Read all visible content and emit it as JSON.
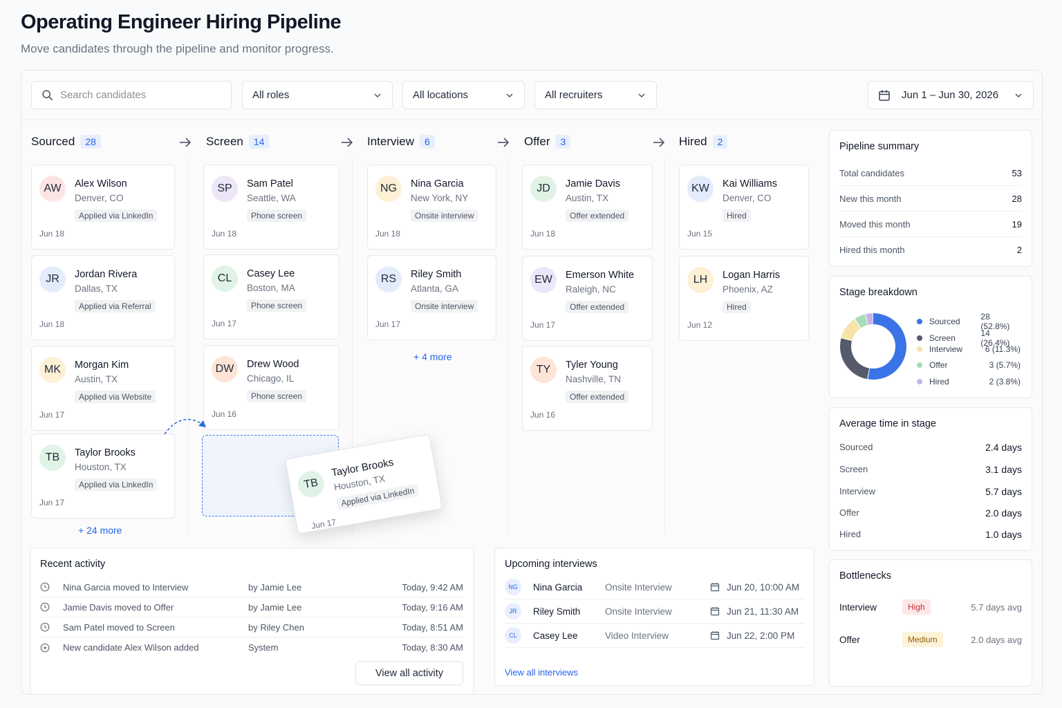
{
  "page": {
    "title": "Operating Engineer Hiring Pipeline",
    "subtitle": "Move candidates through the pipeline and monitor progress."
  },
  "filters": {
    "search_placeholder": "Search candidates",
    "role": "All roles",
    "location": "All locations",
    "recruiter": "All recruiters",
    "date_range": "Jun 1 – Jun 30, 2026"
  },
  "columns": [
    {
      "name": "Sourced",
      "count": "28",
      "more": "+ 24 more"
    },
    {
      "name": "Screen",
      "count": "14",
      "more": ""
    },
    {
      "name": "Interview",
      "count": "6",
      "more": "+ 4 more"
    },
    {
      "name": "Offer",
      "count": "3",
      "more": ""
    },
    {
      "name": "Hired",
      "count": "2",
      "more": ""
    }
  ],
  "cards": {
    "sourced": [
      {
        "initials": "AW",
        "name": "Alex Wilson",
        "location": "Denver, CO",
        "tag": "Applied via LinkedIn",
        "date": "Jun 18",
        "color": "#fde4e4"
      },
      {
        "initials": "JR",
        "name": "Jordan Rivera",
        "location": "Dallas, TX",
        "tag": "Applied via Referral",
        "date": "Jun 18",
        "color": "#e3ecfb"
      },
      {
        "initials": "MK",
        "name": "Morgan Kim",
        "location": "Austin, TX",
        "tag": "Applied via Website",
        "date": "Jun 17",
        "color": "#fdf0d5"
      },
      {
        "initials": "TB",
        "name": "Taylor Brooks",
        "location": "Houston, TX",
        "tag": "Applied via LinkedIn",
        "date": "Jun 17",
        "color": "#e0f3e6"
      }
    ],
    "screen": [
      {
        "initials": "SP",
        "name": "Sam Patel",
        "location": "Seattle, WA",
        "tag": "Phone screen",
        "date": "Jun 18",
        "color": "#ece6f8"
      },
      {
        "initials": "CL",
        "name": "Casey Lee",
        "location": "Boston, MA",
        "tag": "Phone screen",
        "date": "Jun 17",
        "color": "#e0f3e6"
      },
      {
        "initials": "DW",
        "name": "Drew Wood",
        "location": "Chicago, IL",
        "tag": "Phone screen",
        "date": "Jun 16",
        "color": "#fde4d6"
      }
    ],
    "interview": [
      {
        "initials": "NG",
        "name": "Nina Garcia",
        "location": "New York, NY",
        "tag": "Onsite interview",
        "date": "Jun 18",
        "color": "#fdf0d5"
      },
      {
        "initials": "RS",
        "name": "Riley Smith",
        "location": "Atlanta, GA",
        "tag": "Onsite interview",
        "date": "Jun 17",
        "color": "#e3ecfb"
      }
    ],
    "offer": [
      {
        "initials": "JD",
        "name": "Jamie Davis",
        "location": "Austin, TX",
        "tag": "Offer extended",
        "date": "Jun 18",
        "color": "#e0f3e6"
      },
      {
        "initials": "EW",
        "name": "Emerson White",
        "location": "Raleigh, NC",
        "tag": "Offer extended",
        "date": "Jun 17",
        "color": "#ece6f8"
      },
      {
        "initials": "TY",
        "name": "Tyler Young",
        "location": "Nashville, TN",
        "tag": "Offer extended",
        "date": "Jun 16",
        "color": "#fde4d6"
      }
    ],
    "hired": [
      {
        "initials": "KW",
        "name": "Kai Williams",
        "location": "Denver, CO",
        "tag": "Hired",
        "date": "Jun 15",
        "color": "#e3ecfb"
      },
      {
        "initials": "LH",
        "name": "Logan Harris",
        "location": "Phoenix, AZ",
        "tag": "Hired",
        "date": "Jun 12",
        "color": "#fdf0d5"
      }
    ]
  },
  "dragging": {
    "initials": "TB",
    "name": "Taylor Brooks",
    "location": "Houston, TX",
    "tag": "Applied via LinkedIn",
    "date": "Jun 17",
    "color": "#e0f3e6"
  },
  "summary": {
    "title": "Pipeline summary",
    "rows": [
      {
        "label": "Total candidates",
        "value": "53"
      },
      {
        "label": "New this month",
        "value": "28"
      },
      {
        "label": "Moved this month",
        "value": "19"
      },
      {
        "label": "Hired this month",
        "value": "2"
      }
    ]
  },
  "breakdown": {
    "title": "Stage breakdown",
    "stages": [
      {
        "label": "Sourced",
        "count": 28,
        "display": "28 (52.8%)",
        "color": "#3b74e6"
      },
      {
        "label": "Screen",
        "count": 14,
        "display": "14 (26.4%)",
        "color": "#555b6b"
      },
      {
        "label": "Interview",
        "count": 6,
        "display": "6 (11.3%)",
        "color": "#f8e3a8"
      },
      {
        "label": "Offer",
        "count": 3,
        "display": "3 (5.7%)",
        "color": "#a8dcb8"
      },
      {
        "label": "Hired",
        "count": 2,
        "display": "2 (3.8%)",
        "color": "#c3b4ec"
      }
    ]
  },
  "avg_time": {
    "title": "Average time in stage",
    "rows": [
      {
        "label": "Sourced",
        "value": "2.4 days"
      },
      {
        "label": "Screen",
        "value": "3.1 days"
      },
      {
        "label": "Interview",
        "value": "5.7 days"
      },
      {
        "label": "Offer",
        "value": "2.0 days"
      },
      {
        "label": "Hired",
        "value": "1.0 days"
      }
    ]
  },
  "bottlenecks": {
    "title": "Bottlenecks",
    "rows": [
      {
        "stage": "Interview",
        "level": "High",
        "avg": "5.7 days avg",
        "bg": "#fde8e8",
        "fg": "#c53030"
      },
      {
        "stage": "Offer",
        "level": "Medium",
        "avg": "2.0 days avg",
        "bg": "#fdf3d8",
        "fg": "#92600a"
      }
    ]
  },
  "activity": {
    "title": "Recent activity",
    "rows": [
      {
        "text": "Nina Garcia moved to Interview",
        "by": "by Jamie Lee",
        "time": "Today, 9:42 AM"
      },
      {
        "text": "Jamie Davis moved to Offer",
        "by": "by Jamie Lee",
        "time": "Today, 9:16 AM"
      },
      {
        "text": "Sam Patel moved to Screen",
        "by": "by Riley Chen",
        "time": "Today, 8:51 AM"
      },
      {
        "text": "New candidate Alex Wilson added",
        "by": "System",
        "time": "Today, 8:30 AM"
      }
    ],
    "button": "View all activity"
  },
  "interviews": {
    "title": "Upcoming interviews",
    "rows": [
      {
        "initials": "NG",
        "name": "Nina Garcia",
        "type": "Onsite Interview",
        "date": "Jun 20, 10:00 AM"
      },
      {
        "initials": "JR",
        "name": "Riley Smith",
        "type": "Onsite Interview",
        "date": "Jun 21, 11:30 AM"
      },
      {
        "initials": "CL",
        "name": "Casey Lee",
        "type": "Video Interview",
        "date": "Jun 22, 2:00 PM"
      }
    ],
    "link": "View all interviews"
  }
}
